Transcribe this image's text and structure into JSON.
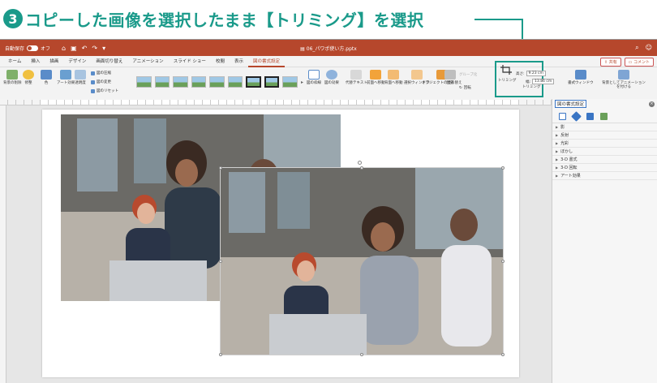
{
  "instruction": {
    "number": "3",
    "text": "コピーした画像を選択したまま【トリミング】を選択"
  },
  "titlebar": {
    "autosave_label": "自動保存",
    "autosave_state": "オフ",
    "file_title": "06_パワポ使い方.pptx",
    "qat_icons": [
      "home-icon",
      "save-icon",
      "undo-icon",
      "redo-icon",
      "more-icon"
    ],
    "right_icons": [
      "search-icon",
      "smiley-icon"
    ]
  },
  "tabs": [
    "ホーム",
    "挿入",
    "描画",
    "デザイン",
    "画面切り替え",
    "アニメーション",
    "スライド ショー",
    "校閲",
    "表示",
    "図の書式設定"
  ],
  "active_tab": "図の書式設定",
  "tab_actions": {
    "share": "共有",
    "comment": "コメント"
  },
  "ribbon": {
    "remove_bg": "背景の削除",
    "corrections": "修整",
    "color": "色",
    "artistic": "アート効果",
    "transparency": "透明度",
    "compress": "図の圧縮",
    "change_picture": "図の変更",
    "reset_picture": "図のリセット",
    "border": "図の枠線",
    "effects": "図の効果",
    "alt_text": "代替テキスト",
    "bring_forward": "前面へ移動",
    "send_backward": "背面へ移動",
    "selection_pane": "選択ウィンドウ",
    "reorder_objects": "オブジェクトの並べ替え",
    "align": "配置",
    "group": "グループ化",
    "rotate": "回転",
    "crop": "トリミング",
    "height_label": "高さ:",
    "height_value": "9.23 cm",
    "width_label": "幅:",
    "width_value": "13.86 cm",
    "format_pane": "書式ウィンドウ",
    "animate_as_bg": "背景としてアニメーションを付ける"
  },
  "pane": {
    "title": "図の書式設定",
    "sections": [
      "影",
      "反射",
      "光彩",
      "ぼかし",
      "3-D 書式",
      "3-D 回転",
      "アート効果"
    ]
  },
  "colors": {
    "accent_teal": "#1a9a8a",
    "ppt_red": "#b6472c"
  }
}
